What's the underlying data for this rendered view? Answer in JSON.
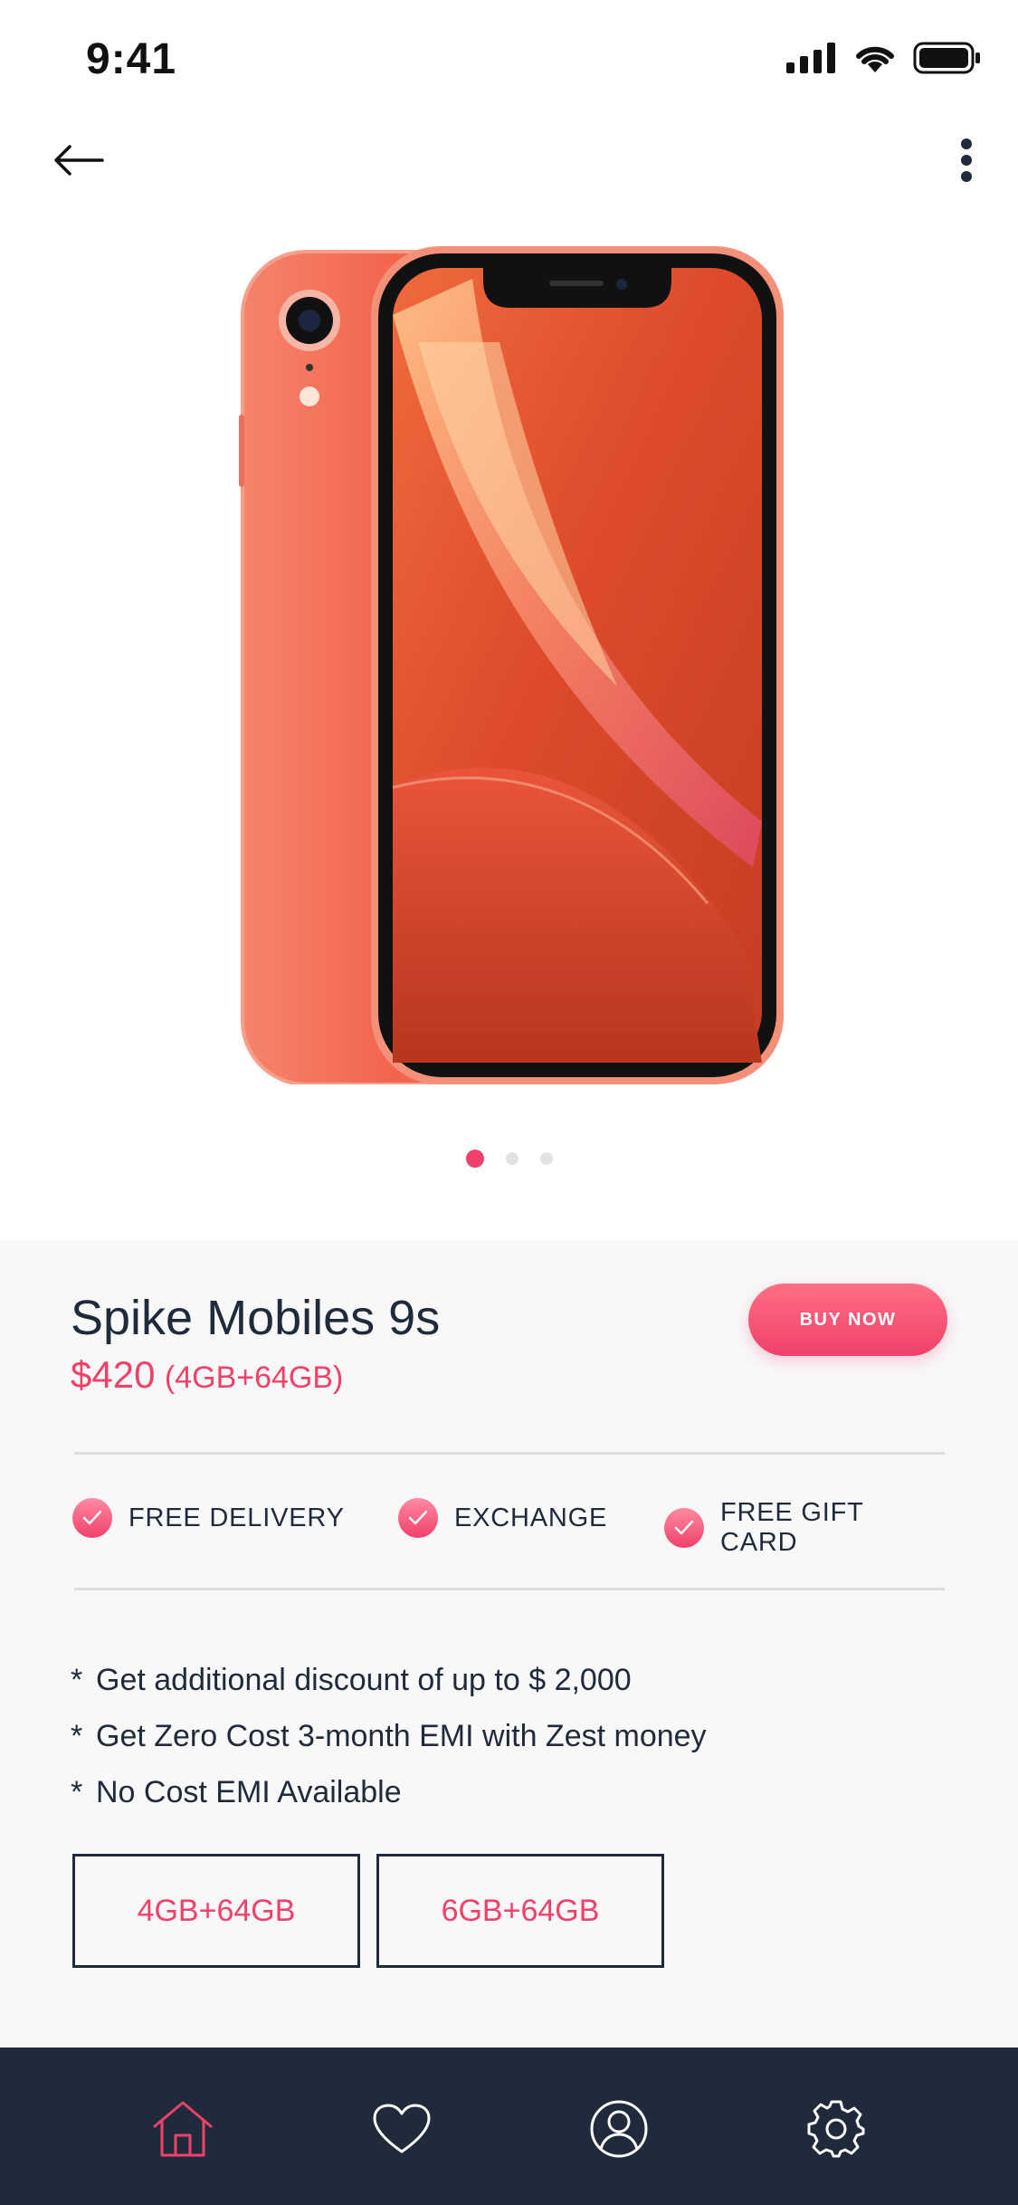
{
  "status_bar": {
    "time": "9:41"
  },
  "product": {
    "name": "Spike Mobiles 9s",
    "price": "$420",
    "variant": "(4GB+64GB)",
    "buy_label": "BUY NOW"
  },
  "carousel": {
    "count": 3,
    "active_index": 0
  },
  "features": [
    {
      "label": "FREE DELIVERY",
      "icon": "check-icon"
    },
    {
      "label": "EXCHANGE",
      "icon": "check-icon"
    },
    {
      "label": "FREE GIFT CARD",
      "icon": "check-icon"
    }
  ],
  "offers": [
    {
      "bullet": "*",
      "text": "Get additional discount of up to  $ 2,000"
    },
    {
      "bullet": "*",
      "text": "Get Zero Cost 3-month EMI with Zest money"
    },
    {
      "bullet": "*",
      "text": "No Cost EMI Available"
    }
  ],
  "variants": [
    {
      "label": "4GB+64GB"
    },
    {
      "label": "6GB+64GB"
    }
  ],
  "tab_bar": {
    "items": [
      {
        "icon": "home-icon",
        "active": true
      },
      {
        "icon": "heart-icon",
        "active": false
      },
      {
        "icon": "profile-icon",
        "active": false
      },
      {
        "icon": "gear-icon",
        "active": false
      }
    ]
  },
  "colors": {
    "accent": "#f0416a",
    "text_dark": "#1f2a3a",
    "panel_bg": "#f8f8f8",
    "tab_bar_bg": "#1f2a3a",
    "product_coral": "#f3644d"
  }
}
